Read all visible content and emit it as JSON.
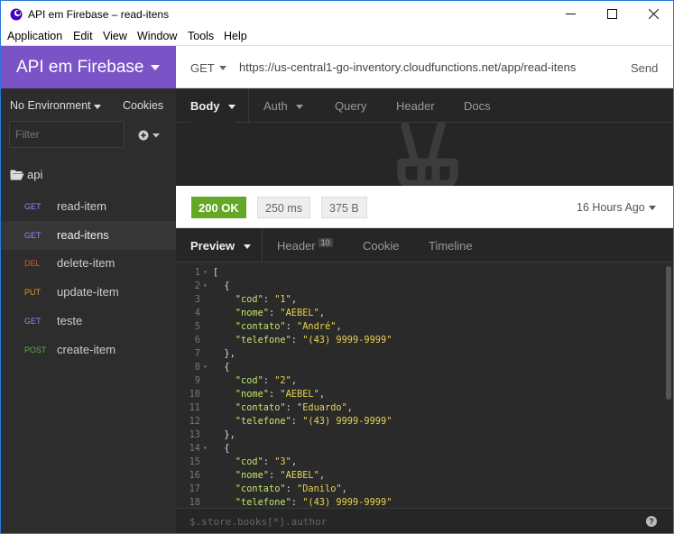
{
  "window": {
    "title": "API em Firebase – read-itens",
    "minimize_icon": "minimize-icon",
    "maximize_icon": "maximize-icon",
    "close_icon": "close-icon"
  },
  "menu": [
    "Application",
    "Edit",
    "View",
    "Window",
    "Tools",
    "Help"
  ],
  "sidebar": {
    "workspace": "API em Firebase",
    "environment": "No Environment",
    "cookies": "Cookies",
    "filter_placeholder": "Filter",
    "folder": "api",
    "requests": [
      {
        "method": "GET",
        "name": "read-item",
        "color": "#8c8cf5"
      },
      {
        "method": "GET",
        "name": "read-itens",
        "color": "#8c8cf5",
        "active": true
      },
      {
        "method": "DEL",
        "name": "delete-item",
        "color": "#e8532f"
      },
      {
        "method": "PUT",
        "name": "update-item",
        "color": "#e8982f"
      },
      {
        "method": "GET",
        "name": "teste",
        "color": "#8c8cf5"
      },
      {
        "method": "POST",
        "name": "create-item",
        "color": "#58b042"
      }
    ]
  },
  "request": {
    "method": "GET",
    "url": "https://us-central1-go-inventory.cloudfunctions.net/app/read-itens",
    "send": "Send",
    "tabs": [
      "Body",
      "Auth",
      "Query",
      "Header",
      "Docs"
    ]
  },
  "response": {
    "status": "200 OK",
    "time": "250 ms",
    "size": "375 B",
    "ago": "16 Hours Ago",
    "tabs": {
      "preview": "Preview",
      "header": "Header",
      "header_count": "10",
      "cookie": "Cookie",
      "timeline": "Timeline"
    },
    "code_lines": [
      {
        "n": "1",
        "fold": true,
        "parts": [
          {
            "t": "[",
            "c": "pun"
          }
        ]
      },
      {
        "n": "2",
        "fold": true,
        "parts": [
          {
            "t": "  {",
            "c": "pun"
          }
        ]
      },
      {
        "n": "3",
        "parts": [
          {
            "t": "    \"cod\"",
            "c": "key"
          },
          {
            "t": ": ",
            "c": "pun"
          },
          {
            "t": "\"1\"",
            "c": "str"
          },
          {
            "t": ",",
            "c": "pun"
          }
        ]
      },
      {
        "n": "4",
        "parts": [
          {
            "t": "    \"nome\"",
            "c": "key"
          },
          {
            "t": ": ",
            "c": "pun"
          },
          {
            "t": "\"AEBEL\"",
            "c": "str"
          },
          {
            "t": ",",
            "c": "pun"
          }
        ]
      },
      {
        "n": "5",
        "parts": [
          {
            "t": "    \"contato\"",
            "c": "key"
          },
          {
            "t": ": ",
            "c": "pun"
          },
          {
            "t": "\"André\"",
            "c": "str"
          },
          {
            "t": ",",
            "c": "pun"
          }
        ]
      },
      {
        "n": "6",
        "parts": [
          {
            "t": "    \"telefone\"",
            "c": "key"
          },
          {
            "t": ": ",
            "c": "pun"
          },
          {
            "t": "\"(43) 9999-9999\"",
            "c": "str"
          }
        ]
      },
      {
        "n": "7",
        "parts": [
          {
            "t": "  },",
            "c": "pun"
          }
        ]
      },
      {
        "n": "8",
        "fold": true,
        "parts": [
          {
            "t": "  {",
            "c": "pun"
          }
        ]
      },
      {
        "n": "9",
        "parts": [
          {
            "t": "    \"cod\"",
            "c": "key"
          },
          {
            "t": ": ",
            "c": "pun"
          },
          {
            "t": "\"2\"",
            "c": "str"
          },
          {
            "t": ",",
            "c": "pun"
          }
        ]
      },
      {
        "n": "10",
        "parts": [
          {
            "t": "    \"nome\"",
            "c": "key"
          },
          {
            "t": ": ",
            "c": "pun"
          },
          {
            "t": "\"AEBEL\"",
            "c": "str"
          },
          {
            "t": ",",
            "c": "pun"
          }
        ]
      },
      {
        "n": "11",
        "parts": [
          {
            "t": "    \"contato\"",
            "c": "key"
          },
          {
            "t": ": ",
            "c": "pun"
          },
          {
            "t": "\"Eduardo\"",
            "c": "str"
          },
          {
            "t": ",",
            "c": "pun"
          }
        ]
      },
      {
        "n": "12",
        "parts": [
          {
            "t": "    \"telefone\"",
            "c": "key"
          },
          {
            "t": ": ",
            "c": "pun"
          },
          {
            "t": "\"(43) 9999-9999\"",
            "c": "str"
          }
        ]
      },
      {
        "n": "13",
        "parts": [
          {
            "t": "  },",
            "c": "pun"
          }
        ]
      },
      {
        "n": "14",
        "fold": true,
        "parts": [
          {
            "t": "  {",
            "c": "pun"
          }
        ]
      },
      {
        "n": "15",
        "parts": [
          {
            "t": "    \"cod\"",
            "c": "key"
          },
          {
            "t": ": ",
            "c": "pun"
          },
          {
            "t": "\"3\"",
            "c": "str"
          },
          {
            "t": ",",
            "c": "pun"
          }
        ]
      },
      {
        "n": "16",
        "parts": [
          {
            "t": "    \"nome\"",
            "c": "key"
          },
          {
            "t": ": ",
            "c": "pun"
          },
          {
            "t": "\"AEBEL\"",
            "c": "str"
          },
          {
            "t": ",",
            "c": "pun"
          }
        ]
      },
      {
        "n": "17",
        "parts": [
          {
            "t": "    \"contato\"",
            "c": "key"
          },
          {
            "t": ": ",
            "c": "pun"
          },
          {
            "t": "\"Danilo\"",
            "c": "str"
          },
          {
            "t": ",",
            "c": "pun"
          }
        ]
      },
      {
        "n": "18",
        "parts": [
          {
            "t": "    \"telefone\"",
            "c": "key"
          },
          {
            "t": ": ",
            "c": "pun"
          },
          {
            "t": "\"(43) 9999-9999\"",
            "c": "str"
          }
        ]
      }
    ],
    "filter_placeholder": "$.store.books[*].author"
  }
}
